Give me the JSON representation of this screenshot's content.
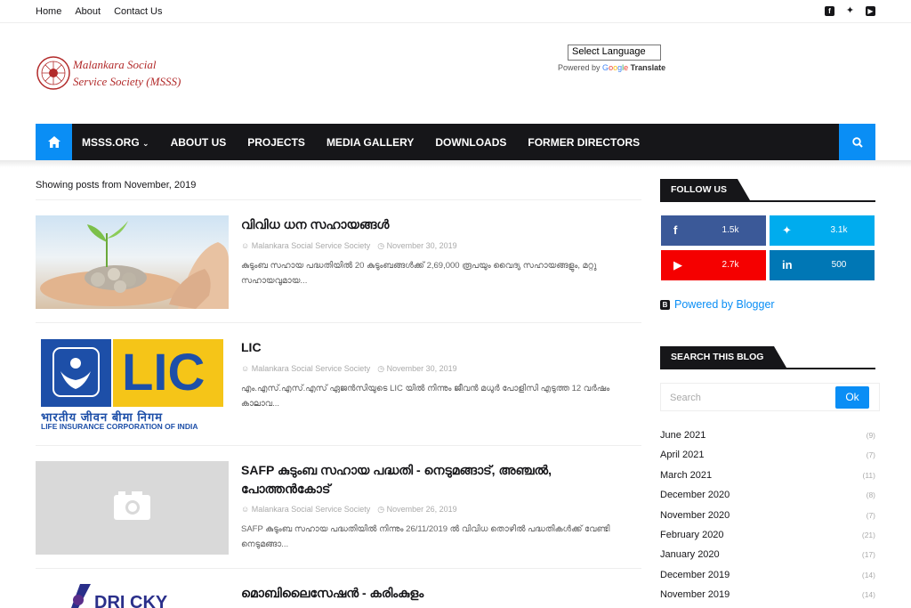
{
  "topbar": {
    "links": [
      "Home",
      "About",
      "Contact Us"
    ],
    "social_icons": [
      "facebook-icon",
      "twitter-icon",
      "youtube-icon"
    ]
  },
  "header": {
    "logo_line1": "Malankara Social",
    "logo_line2": "Service Society  (MSSS)",
    "translate_select": "Select Language",
    "powered_by": "Powered by",
    "google": [
      "G",
      "o",
      "o",
      "g",
      "l",
      "e"
    ],
    "translate": "Translate"
  },
  "nav": {
    "items": [
      "MSSS.ORG",
      "ABOUT US",
      "PROJECTS",
      "MEDIA GALLERY",
      "DOWNLOADS",
      "FORMER DIRECTORS"
    ],
    "accent": "#0a8ef5",
    "bar_color": "#161619"
  },
  "main": {
    "showing": "Showing posts from November, 2019",
    "posts": [
      {
        "title": "വിവിധ ധന സഹായങ്ങൾ",
        "author": "Malankara Social Service Society",
        "date": "November 30, 2019",
        "snippet": "കുടുംബ സഹായ പദ്ധതിയിൽ  20 കുടുംബങ്ങൾക്ക് 2,69,000 രൂപയും വൈദ്യ സഹായങ്ങളും, മറ്റു സഹായവുമായ..."
      },
      {
        "title": "LIC",
        "author": "Malankara Social Service Society",
        "date": "November 30, 2019",
        "snippet": "എം.എസ്.എസ്.എസ് ഏജൻസിയുടെ LIC  യിൽ നിന്നും ജീവൻ മധുർ പോളിസി എടുത്ത 12 വർഷം കാലാവ..."
      },
      {
        "title": "SAFP കുടുംബ സഹായ പദ്ധതി - നെടുമങ്ങാട്, അഞ്ചൽ, പോത്തൻകോട്",
        "author": "Malankara Social Service Society",
        "date": "November 26, 2019",
        "snippet": "SAFP കുടുംബ സഹായ പദ്ധതിയിൽ നിന്നും 26/11/2019 ൽ വിവിധ തൊഴിൽ പദ്ധതികൾക്ക് വേണ്ടി നെടുമങ്ങാ..."
      },
      {
        "title": "മൊബിലൈസേഷൻ - കരിംകുളം"
      }
    ],
    "lic": {
      "big": "LIC",
      "hindi": "भारतीय जीवन बीमा निगम",
      "english": "LIFE INSURANCE CORPORATION OF INDIA"
    }
  },
  "sidebar": {
    "follow_title": "FOLLOW US",
    "social": [
      {
        "icon": "facebook-icon",
        "count": "1.5k",
        "color": "#3b5998"
      },
      {
        "icon": "twitter-icon",
        "count": "3.1k",
        "color": "#00acee"
      },
      {
        "icon": "youtube-icon",
        "count": "2.7k",
        "color": "#f50000"
      },
      {
        "icon": "linkedin-icon",
        "count": "500",
        "color": "#0077b5"
      }
    ],
    "powered_blogger": "Powered by Blogger",
    "search_title": "SEARCH THIS BLOG",
    "search_placeholder": "Search",
    "search_button": "Ok",
    "archive": [
      {
        "month": "June 2021",
        "count": "(9)"
      },
      {
        "month": "April 2021",
        "count": "(7)"
      },
      {
        "month": "March 2021",
        "count": "(11)"
      },
      {
        "month": "December 2020",
        "count": "(8)"
      },
      {
        "month": "November 2020",
        "count": "(7)"
      },
      {
        "month": "February 2020",
        "count": "(21)"
      },
      {
        "month": "January 2020",
        "count": "(17)"
      },
      {
        "month": "December 2019",
        "count": "(14)"
      },
      {
        "month": "November 2019",
        "count": "(14)"
      }
    ]
  }
}
